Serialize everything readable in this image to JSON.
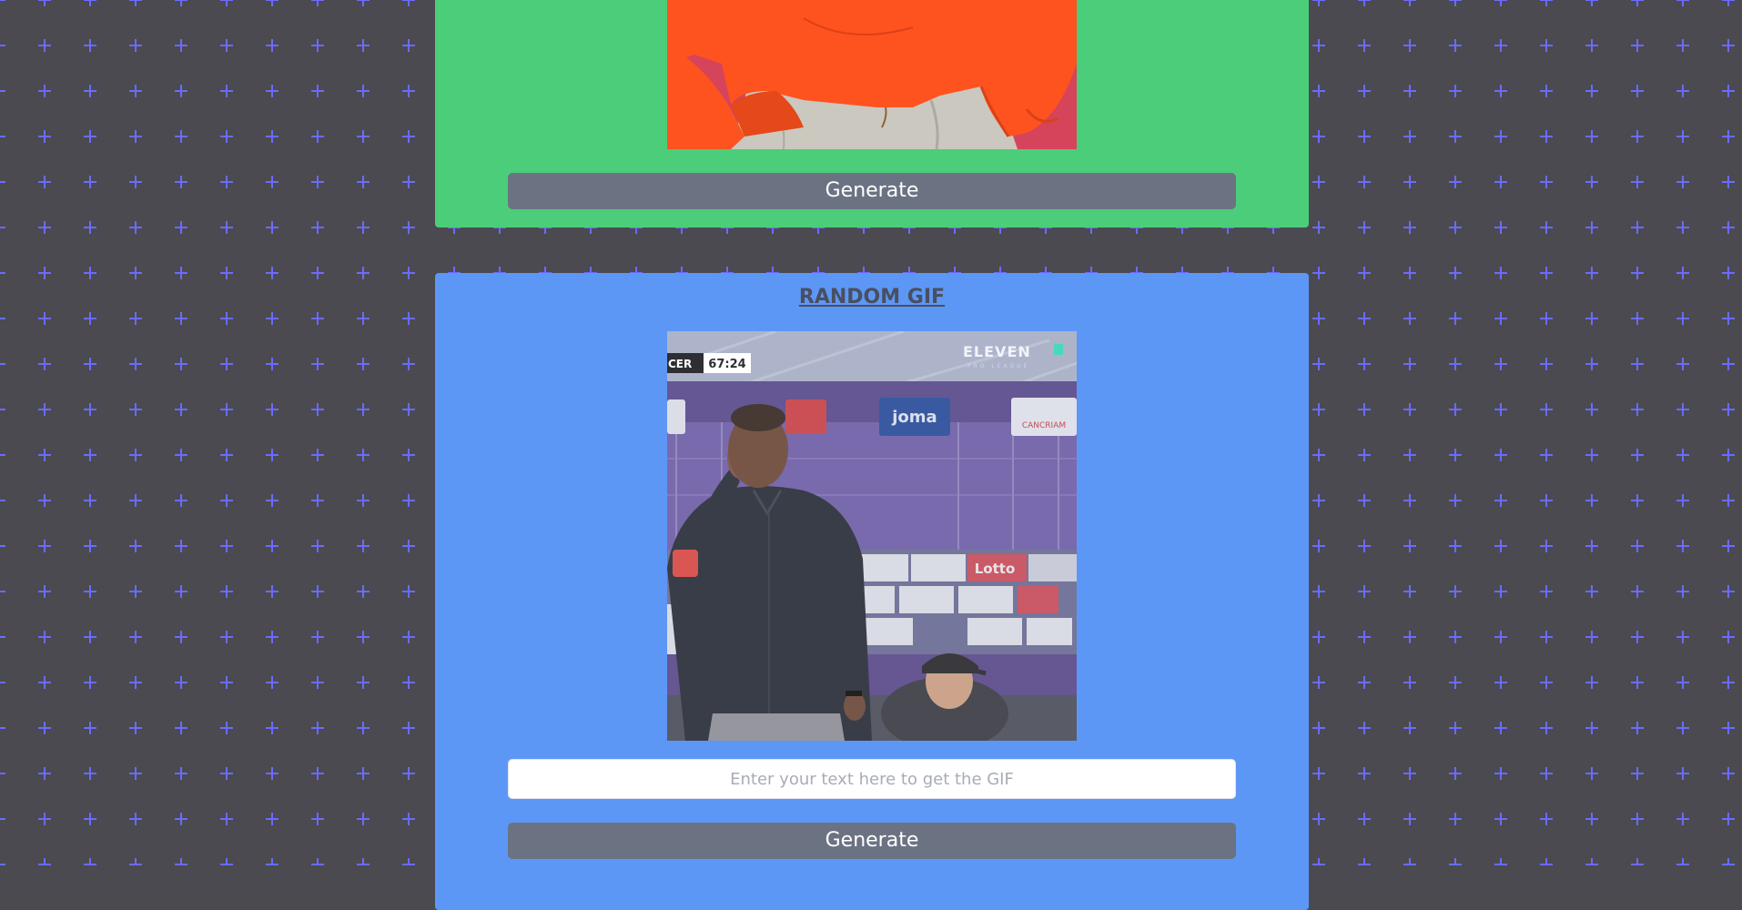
{
  "background": {
    "color": "#4a4a50",
    "pattern_icon": "plus-icon",
    "pattern_color": "#6b6bff"
  },
  "tag_card": {
    "color": "#4ccd79",
    "gif_alt": "Person in orange hoodie and light jeans on a red background",
    "generate_label": "Generate"
  },
  "random_card": {
    "color": "#5d97f6",
    "title": "RANDOM GIF",
    "gif_alt": "Man in dark shirt gesturing at the sideline of a football match",
    "gif_overlay": {
      "team_abbrev": "CER",
      "match_clock": "67:24",
      "broadcaster_logo": "ELEVEN",
      "broadcaster_sub": "PRO LEAGUE",
      "sponsor_board": "joma",
      "sponsor_small": "CANCRIAM",
      "sponsor_lotto": "Lotto"
    },
    "search_placeholder": "Enter your text here to get the GIF",
    "search_value": "",
    "generate_label": "Generate"
  }
}
